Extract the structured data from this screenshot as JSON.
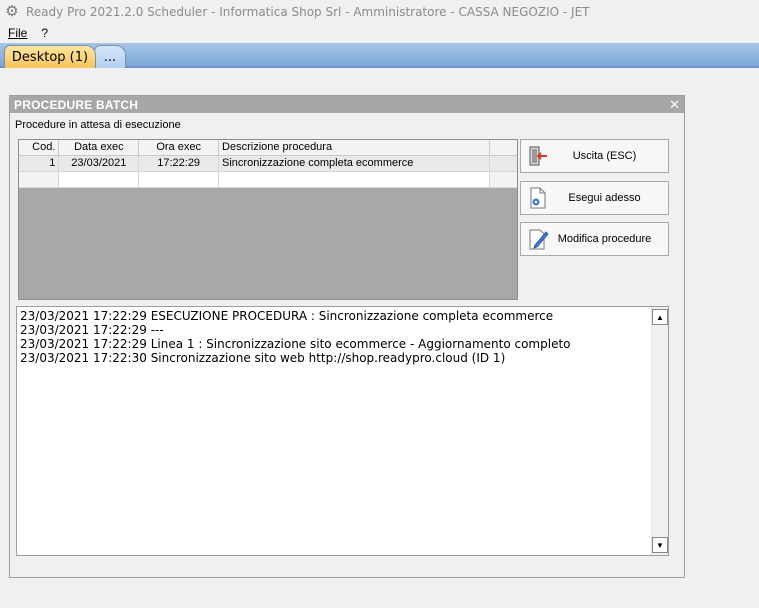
{
  "window": {
    "title": "Ready Pro 2021.2.0 Scheduler  - Informatica Shop Srl - Amministratore - CASSA NEGOZIO - JET"
  },
  "menu": {
    "file": "File",
    "help": "?"
  },
  "tabs": [
    {
      "label": "Desktop (1)"
    },
    {
      "label": "..."
    }
  ],
  "panel": {
    "title": "PROCEDURE BATCH",
    "pending_label": "Procedure in attesa di esecuzione",
    "grid": {
      "columns": [
        "Cod.",
        "Data exec",
        "Ora exec",
        "Descrizione procedura"
      ],
      "rows": [
        {
          "cod": "1",
          "data": "23/03/2021",
          "ora": "17:22:29",
          "desc": "Sincronizzazione completa ecommerce"
        }
      ]
    },
    "buttons": {
      "exit": "Uscita (ESC)",
      "run": "Esegui adesso",
      "edit": "Modifica procedure"
    },
    "log": [
      "23/03/2021 17:22:29 ESECUZIONE PROCEDURA : Sincronizzazione completa ecommerce",
      "23/03/2021 17:22:29 ---",
      "23/03/2021 17:22:29 Linea 1 : Sincronizzazione sito ecommerce - Aggiornamento completo",
      "23/03/2021 17:22:30 Sincronizzazione sito web http://shop.readypro.cloud (ID 1)"
    ]
  },
  "icons": {
    "app": "gear-icon",
    "close": "close-icon",
    "exit": "exit-door-icon",
    "run": "run-gear-icon",
    "edit": "edit-pencil-icon"
  }
}
